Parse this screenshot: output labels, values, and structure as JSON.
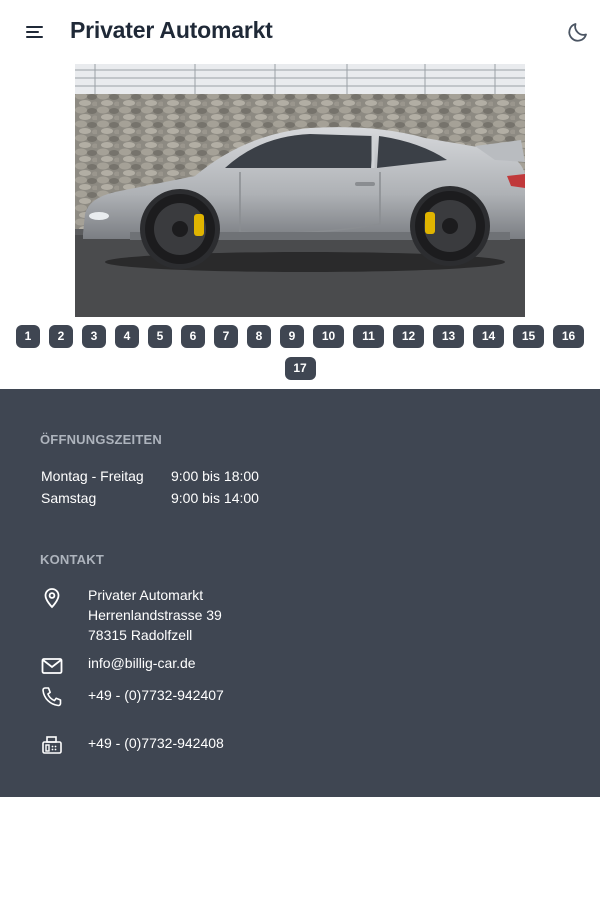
{
  "header": {
    "title": "Privater Automarkt",
    "menu_icon": "hamburger-menu-icon",
    "theme_icon": "moon-icon"
  },
  "gallery": {
    "image_description": "silver sports car on asphalt in front of stone wall",
    "pages_row1": [
      "1",
      "2",
      "3",
      "4",
      "5",
      "6",
      "7",
      "8",
      "9",
      "10",
      "11",
      "12",
      "13",
      "14",
      "15",
      "16"
    ],
    "pages_row2": [
      "17"
    ]
  },
  "footer": {
    "hours_heading": "ÖFFNUNGSZEITEN",
    "hours": [
      {
        "day": "Montag - Freitag",
        "time": "9:00 bis 18:00"
      },
      {
        "day": "Samstag",
        "time": "9:00 bis 14:00"
      }
    ],
    "contact_heading": "KONTAKT",
    "address": {
      "name": "Privater Automarkt",
      "street": "Herrenlandstrasse 39",
      "city": "78315 Radolfzell"
    },
    "email": "info@billig-car.de",
    "phone": "+49 - (0)7732-942407",
    "fax": "+49 - (0)7732-942408"
  },
  "colors": {
    "footer_bg": "#3f4652",
    "heading_muted": "#aeb4bd",
    "title_text": "#1f2937"
  }
}
